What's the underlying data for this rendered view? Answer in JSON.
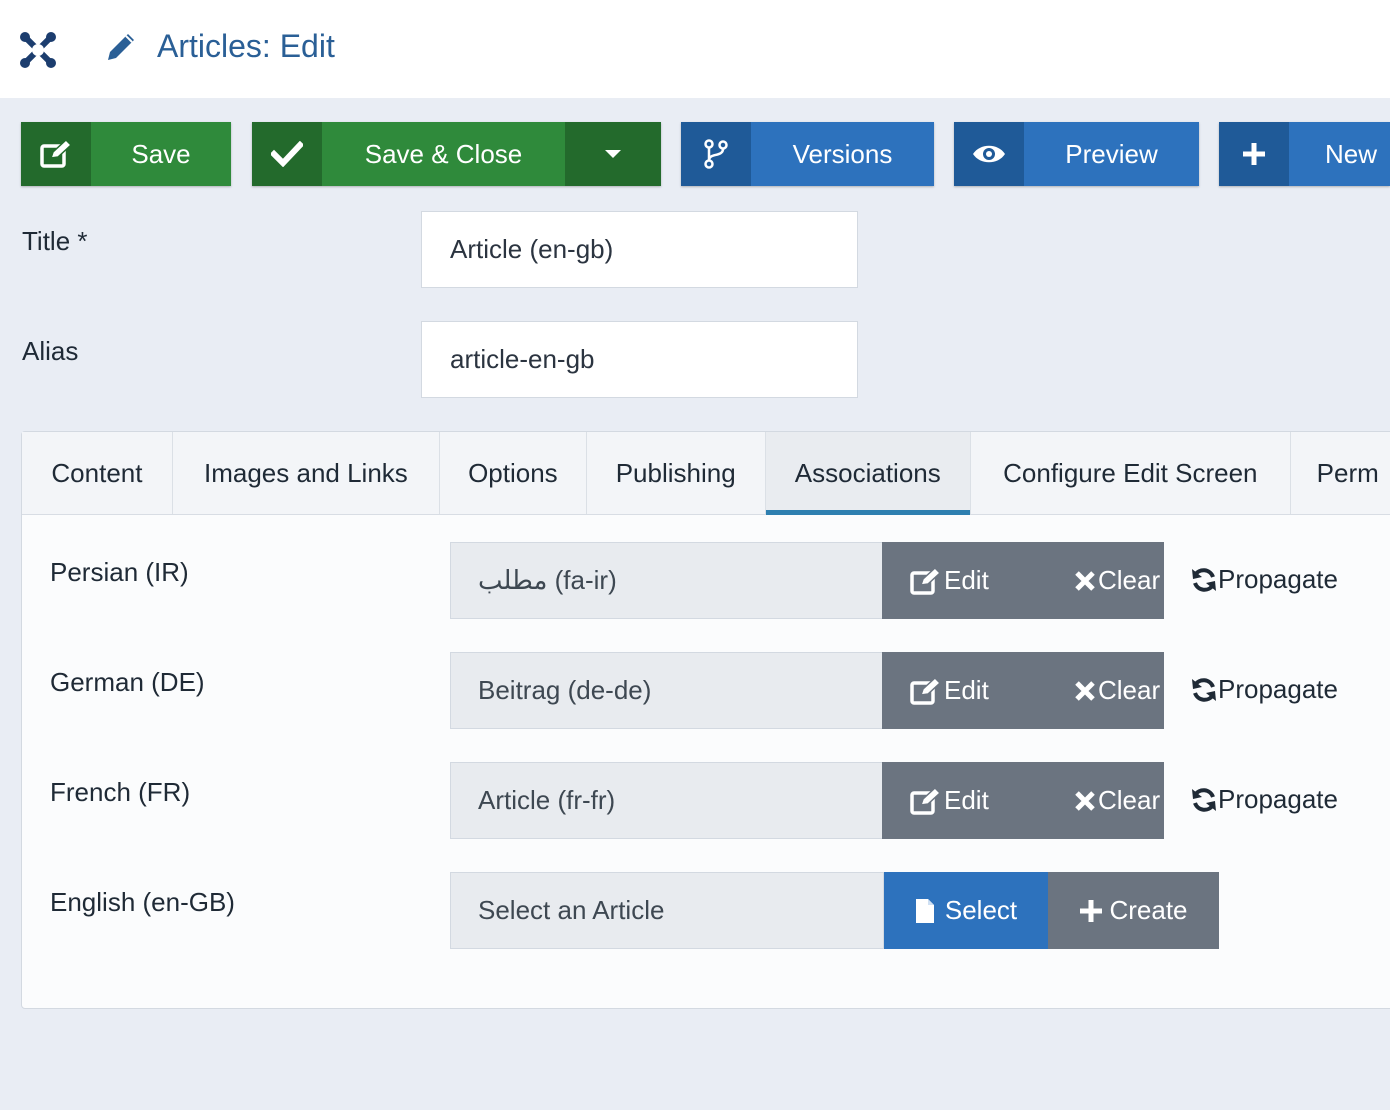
{
  "header": {
    "title": "Articles: Edit",
    "logo_icon": "joomla-logo-icon",
    "title_icon": "pencil-icon"
  },
  "toolbar": {
    "save": "Save",
    "save_close": "Save & Close",
    "versions": "Versions",
    "preview": "Preview",
    "new": "New"
  },
  "form": {
    "title_label": "Title *",
    "title_value": "Article (en-gb)",
    "alias_label": "Alias",
    "alias_value": "article-en-gb"
  },
  "tabs": [
    {
      "label": "Content"
    },
    {
      "label": "Images and Links"
    },
    {
      "label": "Options"
    },
    {
      "label": "Publishing"
    },
    {
      "label": "Associations",
      "active": true
    },
    {
      "label": "Configure Edit Screen"
    },
    {
      "label": "Perm"
    }
  ],
  "associations": [
    {
      "language": "Persian (IR)",
      "value": "مطلب (fa-ir)",
      "edit": "Edit",
      "clear": "Clear",
      "propagate": "Propagate"
    },
    {
      "language": "German (DE)",
      "value": "Beitrag (de-de)",
      "edit": "Edit",
      "clear": "Clear",
      "propagate": "Propagate"
    },
    {
      "language": "French (FR)",
      "value": "Article (fr-fr)",
      "edit": "Edit",
      "clear": "Clear",
      "propagate": "Propagate"
    },
    {
      "language": "English (en-GB)",
      "value": "Select an Article",
      "select": "Select",
      "create": "Create"
    }
  ],
  "colors": {
    "green_dark": "#236a2c",
    "green": "#2f8a3b",
    "blue_dark": "#1f5a98",
    "blue": "#2d72bd",
    "grey_button": "#6b7480",
    "tab_accent": "#2e7fb0",
    "title_blue": "#2a5f96"
  }
}
